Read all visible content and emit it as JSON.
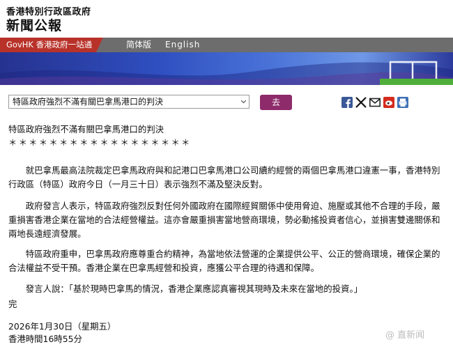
{
  "header": {
    "gov_name": "香港特別行政區政府",
    "press_title": "新聞公報"
  },
  "nav": {
    "govhk": "GovHK 香港政府一站通",
    "simplified": "简体版",
    "english": "English"
  },
  "toolbar": {
    "select_value": "特區政府強烈不滿有關巴拿馬港口的判決",
    "go_label": "去"
  },
  "share": [
    "facebook-icon",
    "x-icon",
    "email-icon",
    "weibo-icon",
    "print-icon"
  ],
  "colors": {
    "govhk_red": "#b8322a",
    "go_purple": "#8e2b6b",
    "navbar_gray": "#6d6d6d"
  },
  "article": {
    "title": "特區政府強烈不滿有關巴拿馬港口的判決",
    "stars": "＊＊＊＊＊＊＊＊＊＊＊＊＊＊＊＊＊＊",
    "paragraphs": [
      "就巴拿馬最高法院裁定巴拿馬政府與和記港口巴拿馬港口公司續約經營的兩個巴拿馬港口違憲一事，香港特別行政區（特區）政府今日（一月三十日）表示強烈不滿及堅決反對。",
      "政府發言人表示，特區政府強烈反對任何外國政府在國際經貿關係中使用脅迫、施壓或其他不合理的手段，嚴重損害香港企業在當地的合法經營權益。這亦會嚴重損害當地營商環境，勢必動搖投資者信心，並損害雙邊關係和兩地長遠經濟發展。",
      "特區政府重申，巴拿馬政府應尊重合約精神，為當地依法營運的企業提供公平、公正的營商環境，確保企業的合法權益不受干預。香港企業在巴拿馬經營和投資，應獲公平合理的待遇和保障。",
      "發言人說：「基於現時巴拿馬的情況，香港企業應認真審視其現時及未來在當地的投資。」"
    ],
    "end_mark": "完",
    "date": "2026年1月30日（星期五）",
    "time": "香港時間16時55分"
  },
  "watermark": "@ 直新闻"
}
